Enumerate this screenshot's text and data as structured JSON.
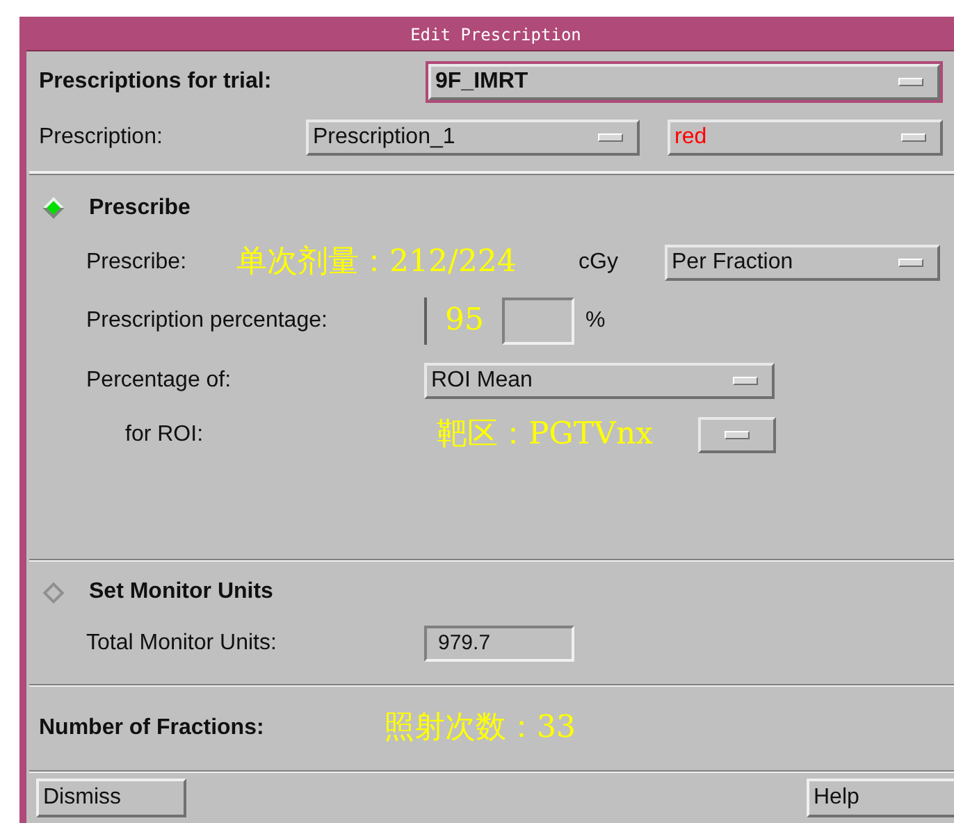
{
  "window": {
    "title": "Edit Prescription"
  },
  "trial": {
    "label": "Prescriptions for trial:",
    "value": "9F_IMRT"
  },
  "prescription": {
    "label": "Prescription:",
    "name": "Prescription_1",
    "line_color_name": "red"
  },
  "prescribe_section": {
    "label": "Prescribe",
    "selected": true,
    "prescribe": {
      "label": "Prescribe:",
      "annotation": "单次剂量：212/224",
      "unit": "cGy",
      "mode": "Per Fraction"
    },
    "percentage": {
      "label": "Prescription percentage:",
      "annotation": "95",
      "unit": "%"
    },
    "percentage_of": {
      "label": "Percentage of:",
      "value": "ROI Mean"
    },
    "for_roi": {
      "label": "for ROI:",
      "annotation": "靶区：PGTVnx"
    }
  },
  "monitor_section": {
    "label": "Set Monitor Units",
    "selected": false,
    "total": {
      "label": "Total Monitor Units:",
      "value": "979.7"
    }
  },
  "fractions": {
    "label": "Number of Fractions:",
    "annotation": "照射次数：33"
  },
  "buttons": [
    "Dismiss",
    "Help"
  ]
}
